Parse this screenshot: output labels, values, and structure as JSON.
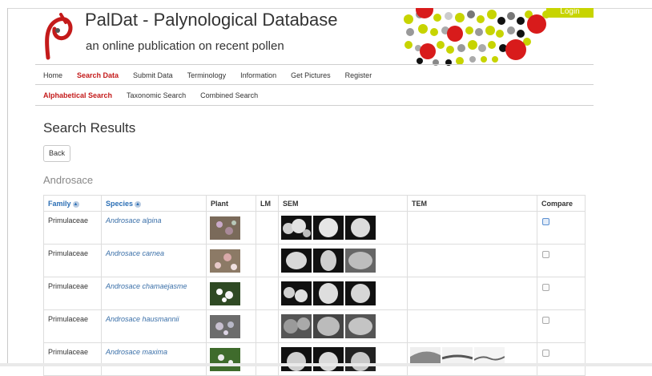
{
  "site": {
    "title": "PalDat - Palynological Database",
    "subtitle": "an online publication on recent pollen",
    "login_label": "Login"
  },
  "nav": {
    "items": [
      {
        "label": "Home",
        "active": false
      },
      {
        "label": "Search Data",
        "active": true
      },
      {
        "label": "Submit Data",
        "active": false
      },
      {
        "label": "Terminology",
        "active": false
      },
      {
        "label": "Information",
        "active": false
      },
      {
        "label": "Get Pictures",
        "active": false
      },
      {
        "label": "Register",
        "active": false
      }
    ]
  },
  "subnav": {
    "items": [
      {
        "label": "Alphabetical Search",
        "active": true
      },
      {
        "label": "Taxonomic Search",
        "active": false
      },
      {
        "label": "Combined Search",
        "active": false
      }
    ]
  },
  "main": {
    "heading": "Search Results",
    "back_label": "Back",
    "genus": "Androsace"
  },
  "table": {
    "headers": {
      "family": "Family",
      "species": "Species",
      "plant": "Plant",
      "lm": "LM",
      "sem": "SEM",
      "tem": "TEM",
      "compare": "Compare"
    },
    "rows": [
      {
        "family": "Primulaceae",
        "species": "Androsace alpina"
      },
      {
        "family": "Primulaceae",
        "species": "Androsace carnea"
      },
      {
        "family": "Primulaceae",
        "species": "Androsace chamaejasme"
      },
      {
        "family": "Primulaceae",
        "species": "Androsace hausmannii"
      },
      {
        "family": "Primulaceae",
        "species": "Androsace maxima"
      }
    ]
  },
  "colors": {
    "accent_red": "#c41a1a",
    "link_blue": "#3a6fa8",
    "login_green": "#c7d400"
  }
}
